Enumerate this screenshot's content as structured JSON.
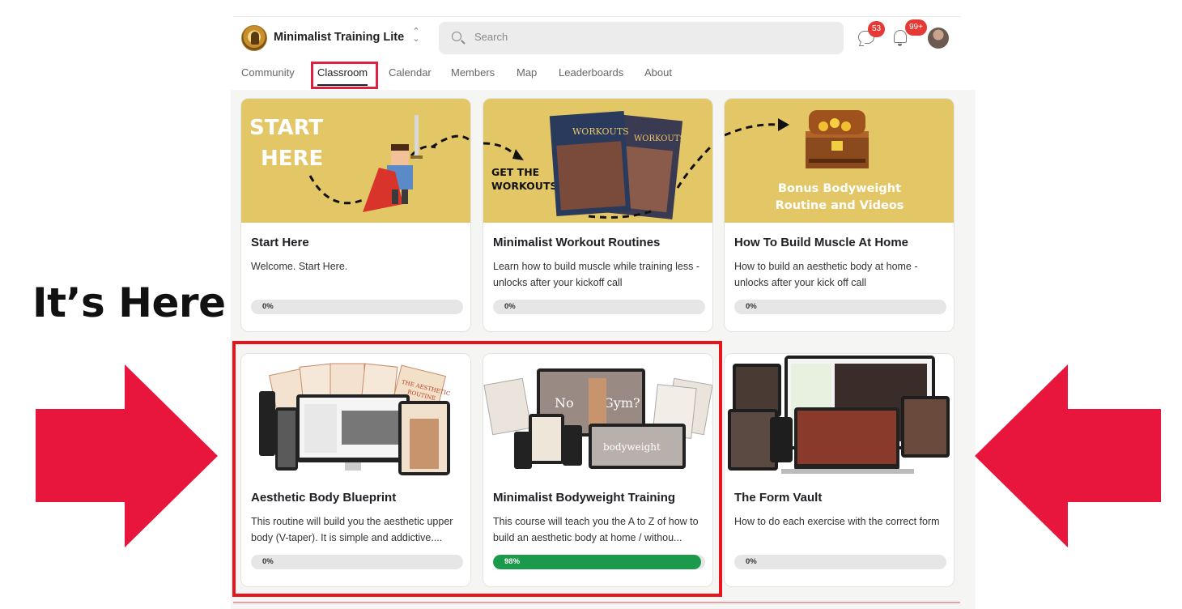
{
  "header": {
    "brand": "Minimalist Training Lite",
    "search_placeholder": "Search",
    "chat_badge": "53",
    "notifications_badge": "99+"
  },
  "tabs": [
    {
      "label": "Community"
    },
    {
      "label": "Classroom",
      "active": true
    },
    {
      "label": "Calendar"
    },
    {
      "label": "Members"
    },
    {
      "label": "Map"
    },
    {
      "label": "Leaderboards"
    },
    {
      "label": "About"
    }
  ],
  "courses": [
    {
      "title": "Start Here",
      "description": "Welcome. Start Here.",
      "progress_label": "0%",
      "progress": 0,
      "image_text": [
        "START",
        "HERE"
      ]
    },
    {
      "title": "Minimalist Workout Routines",
      "description": "Learn how to build muscle while training less - unlocks after your kickoff call",
      "progress_label": "0%",
      "progress": 0,
      "image_text": [
        "GET THE",
        "WORKOUTS"
      ]
    },
    {
      "title": "How To Build Muscle At Home",
      "description": "How to build an aesthetic body at home - unlocks after your kick off call",
      "progress_label": "0%",
      "progress": 0,
      "image_text": [
        "Bonus Bodyweight",
        "Routine and Videos"
      ]
    },
    {
      "title": "Aesthetic Body Blueprint",
      "description": "This routine will build you the aesthetic upper body (V-taper). It is simple and addictive....",
      "progress_label": "0%",
      "progress": 0,
      "image_text": [
        "THE AESTHETIC",
        "ROUTINE"
      ]
    },
    {
      "title": "Minimalist Bodyweight Training",
      "description": "This course will teach you the A to Z of how to build an aesthetic body at home / withou...",
      "progress_label": "98%",
      "progress": 98,
      "image_text": [
        "No",
        "Gym?",
        "bodyweight"
      ]
    },
    {
      "title": "The Form Vault",
      "description": "How to do each exercise with the correct form",
      "progress_label": "0%",
      "progress": 0,
      "image_text": []
    }
  ],
  "annotation": {
    "label": "It’s Here",
    "color": "#e8141c",
    "arrow_color": "#e8163c"
  },
  "colors": {
    "progress_fill": "#1a9a4a",
    "card_yellow": "#e3c766",
    "tab_highlight": "#e02040"
  }
}
